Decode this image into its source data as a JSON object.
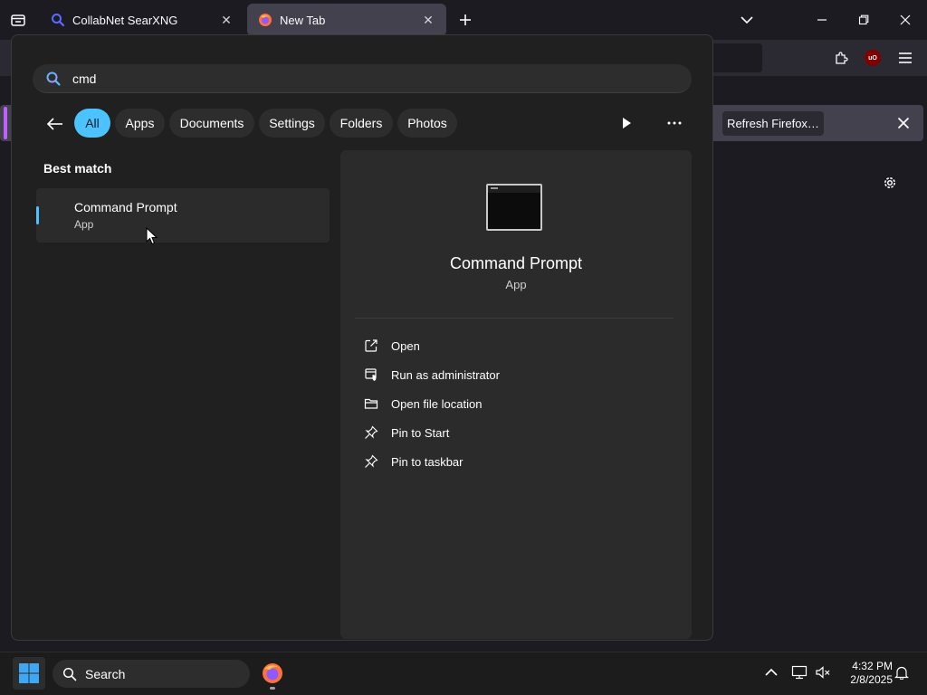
{
  "browser": {
    "tabs": [
      {
        "label": "CollabNet SearXNG",
        "icon": "search-favicon",
        "active": false
      },
      {
        "label": "New Tab",
        "icon": "firefox-favicon",
        "active": true
      }
    ],
    "notification": {
      "button_label": "Refresh Firefox…"
    }
  },
  "start_menu": {
    "search": {
      "query": "cmd",
      "icon": "search-icon"
    },
    "filters": [
      "All",
      "Apps",
      "Documents",
      "Settings",
      "Folders",
      "Photos"
    ],
    "selected_filter": "All",
    "section_title": "Best match",
    "result": {
      "name": "Command Prompt",
      "type": "App"
    },
    "preview": {
      "name": "Command Prompt",
      "type": "App",
      "actions": [
        {
          "label": "Open",
          "icon": "open-external-icon"
        },
        {
          "label": "Run as administrator",
          "icon": "admin-shield-icon"
        },
        {
          "label": "Open file location",
          "icon": "folder-icon"
        },
        {
          "label": "Pin to Start",
          "icon": "pin-icon"
        },
        {
          "label": "Pin to taskbar",
          "icon": "pin-icon"
        }
      ]
    }
  },
  "taskbar": {
    "search_label": "Search",
    "clock": {
      "time": "4:32 PM",
      "date": "2/8/2025"
    }
  },
  "colors": {
    "accent": "#4cc2ff",
    "panel_bg": "#202020",
    "browser_bg": "#1c1b22"
  }
}
